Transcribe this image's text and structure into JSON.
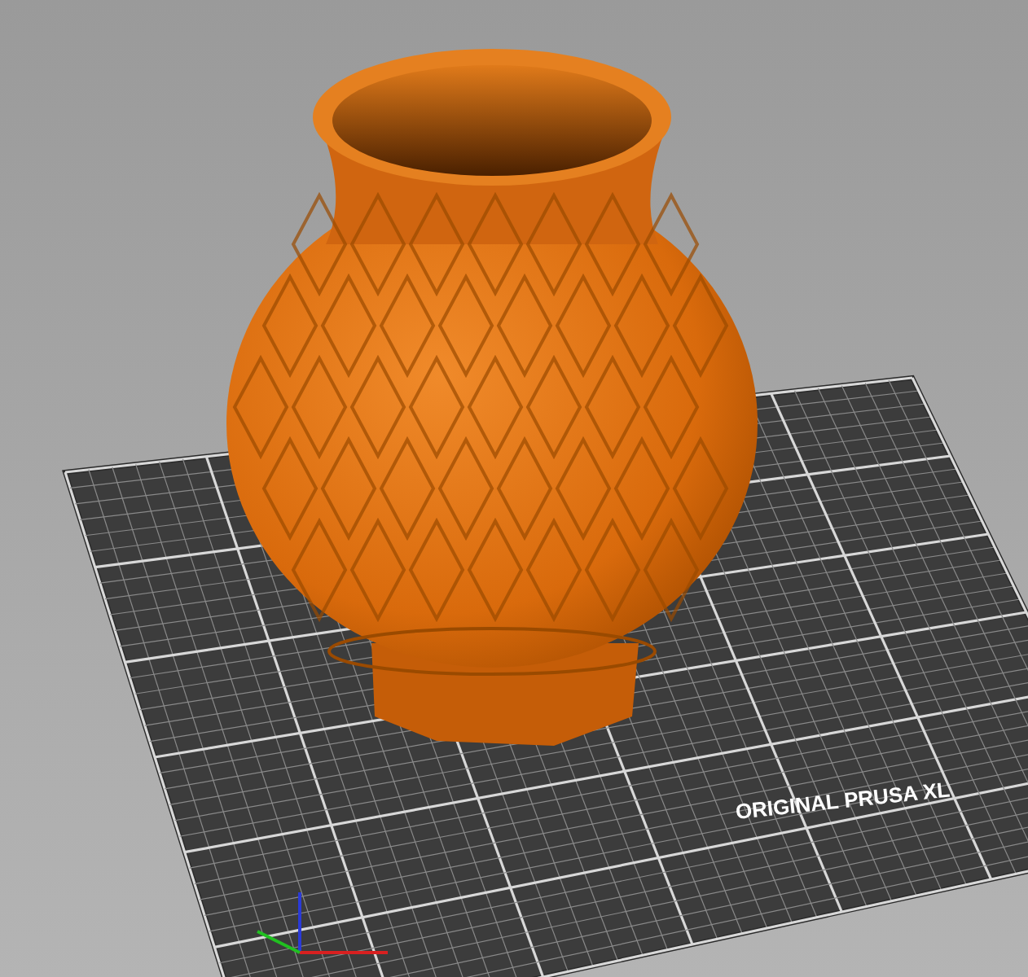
{
  "viewport": {
    "bed_label": "ORIGINAL PRUSA XL"
  }
}
